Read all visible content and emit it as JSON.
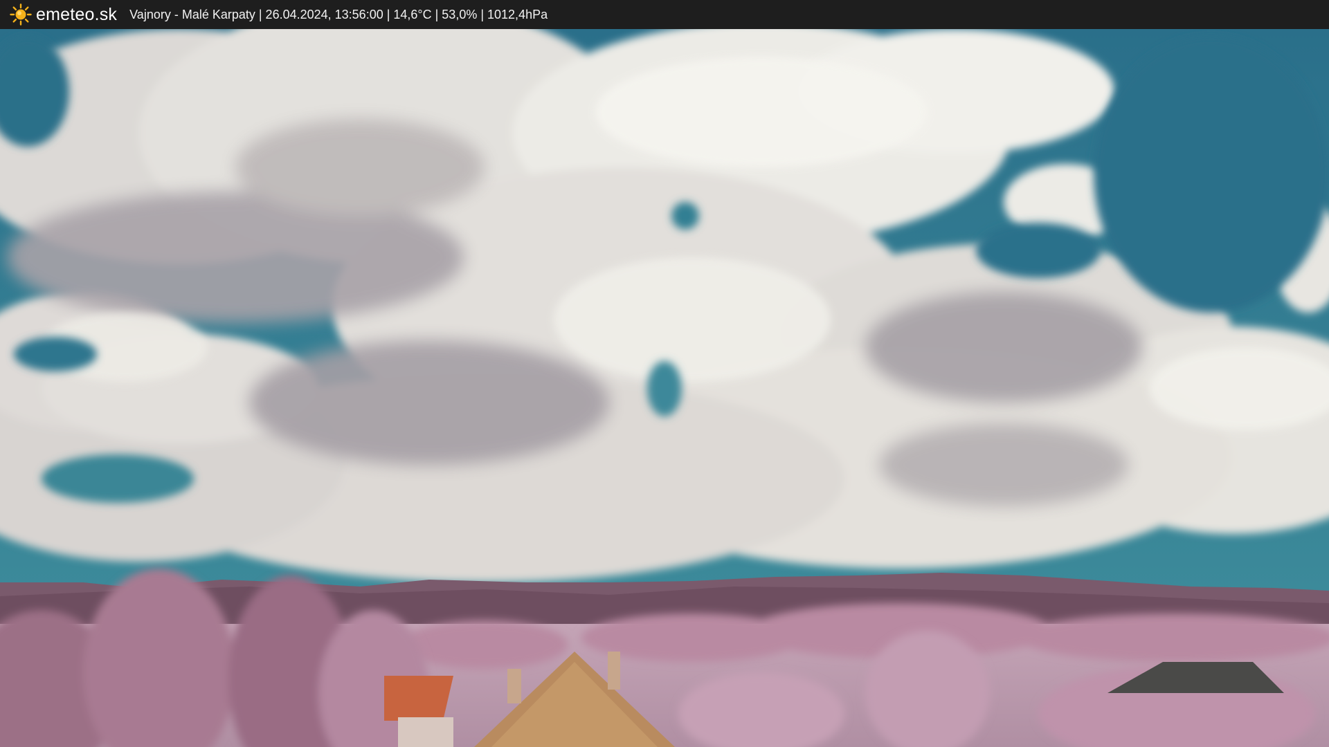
{
  "header": {
    "brand": "emeteo.sk",
    "logo_icon": "sun-icon",
    "caption": "Vajnory - Malé Karpaty | 26.04.2024, 13:56:00 | 14,6°C | 53,0% | 1012,4hPa"
  },
  "colors": {
    "header_bg": "#1e1e1e",
    "sun": "#f5b21a",
    "sky": "#2f7d96",
    "foliage_infrared": "#b07f98"
  }
}
